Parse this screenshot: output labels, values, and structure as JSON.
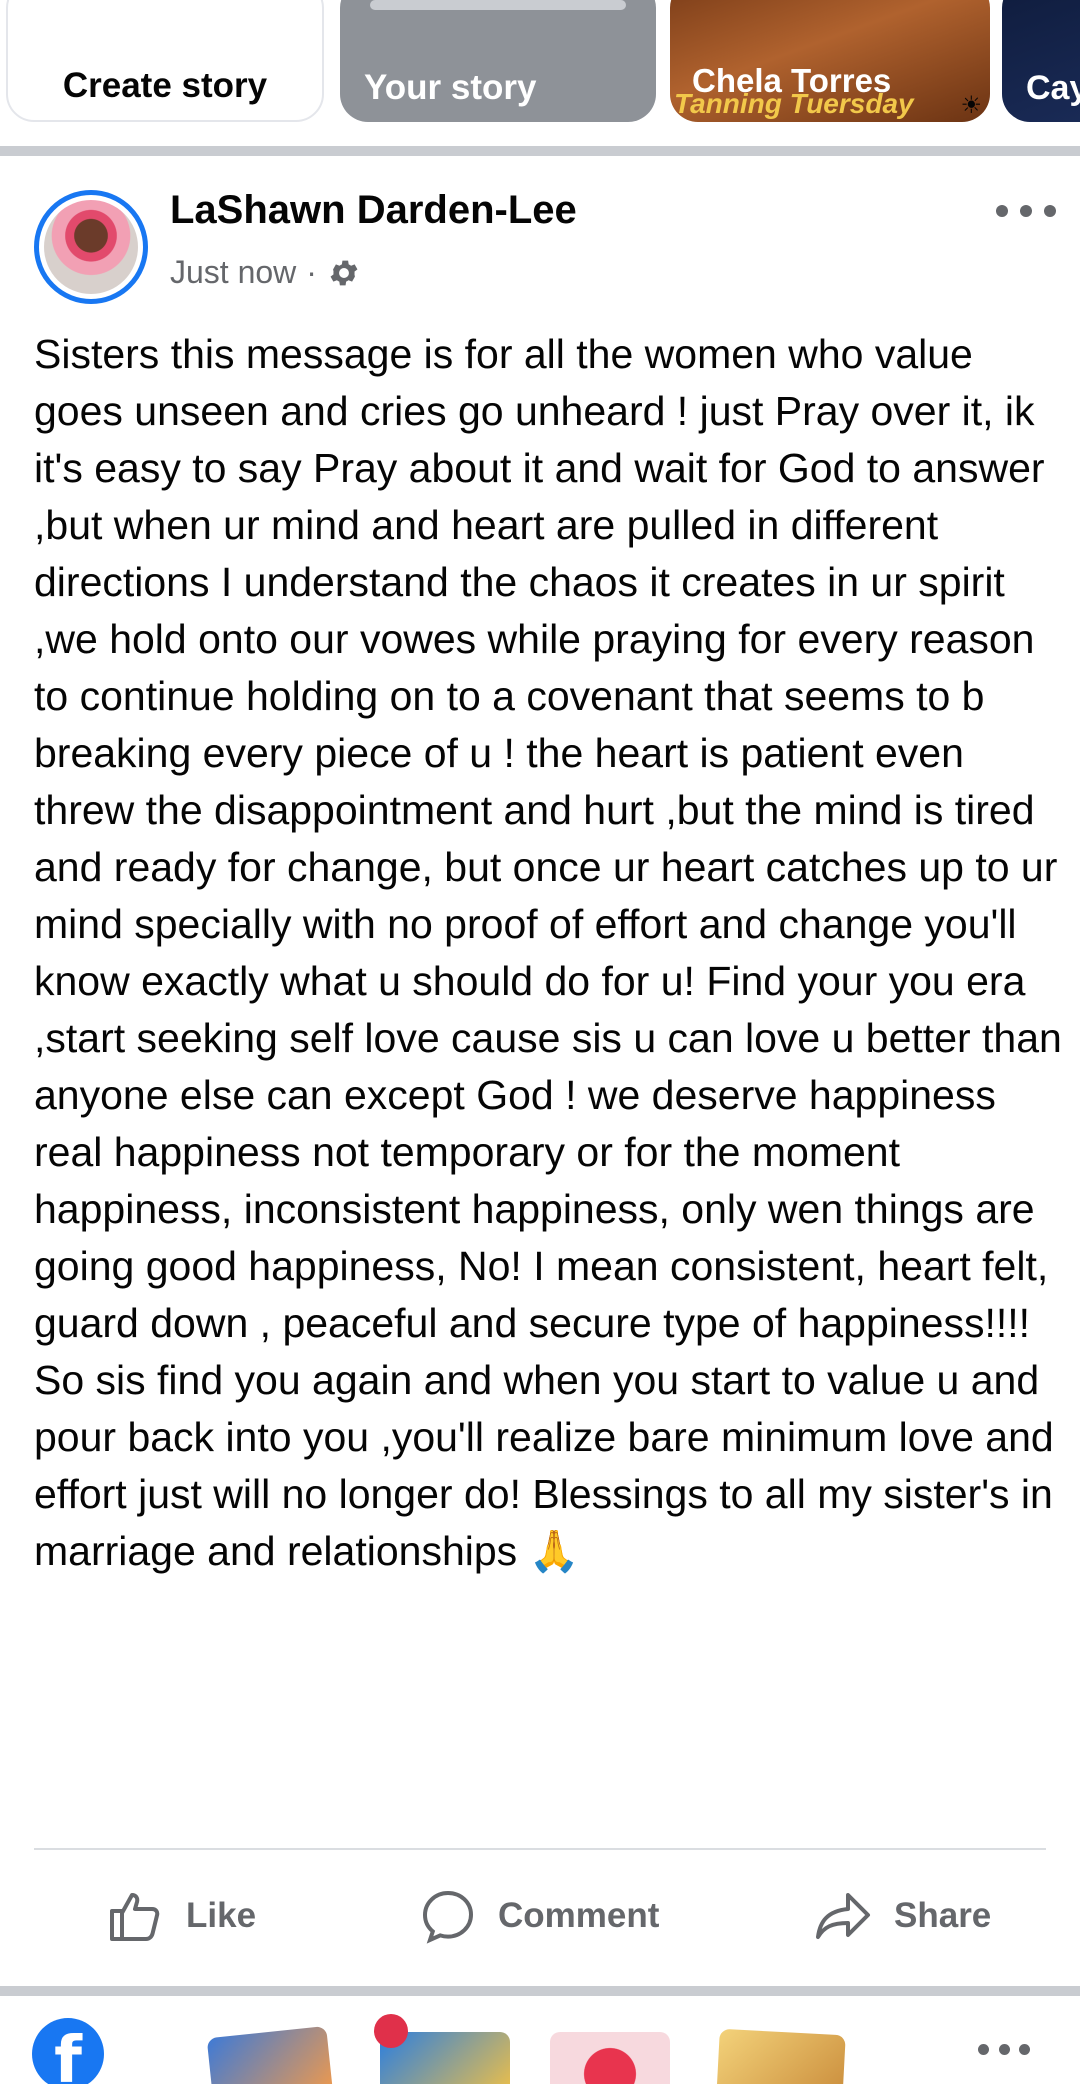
{
  "stories": {
    "create_label": "Create story",
    "your_label": "Your story",
    "items": [
      {
        "name": "Chela Torres",
        "caption": "Tanning Tuersday"
      },
      {
        "name": "Cay"
      }
    ]
  },
  "post": {
    "author": "LaShawn Darden-Lee",
    "timestamp": "Just now",
    "separator": "·",
    "audience_icon": "gear-icon",
    "text": "Sisters this message is for all the women who value goes unseen and cries go unheard ! just Pray over it, ik it's easy to say Pray about it and wait for God to answer ,but when ur mind and heart are pulled in different directions I understand the chaos it creates in ur spirit ,we hold onto our vowes while praying for every reason to continue holding on to a covenant that seems  to b breaking every piece of u ! the heart is patient even threw the disappointment and hurt ,but the mind is tired and ready for change, but once ur heart catches up to ur mind specially with no proof of effort and change you'll know exactly what u should do for u! Find your you era ,start seeking self love cause sis u can love u better than anyone else can except God ! we deserve happiness real happiness not temporary or for the moment happiness, inconsistent happiness, only wen things are going good happiness, No! I mean consistent, heart felt, guard down , peaceful and secure type of happiness!!!! So sis find you again and when you start to value u and pour back into you ,you'll realize bare minimum love and effort just will no longer do! Blessings to all my sister's in marriage and relationships 🙏"
  },
  "actions": {
    "like": "Like",
    "comment": "Comment",
    "share": "Share"
  },
  "bottom_nav": {
    "logo_letter": "f"
  },
  "colors": {
    "brand_blue": "#1877f2",
    "secondary_text": "#65676b",
    "divider": "#c9ccd1"
  }
}
